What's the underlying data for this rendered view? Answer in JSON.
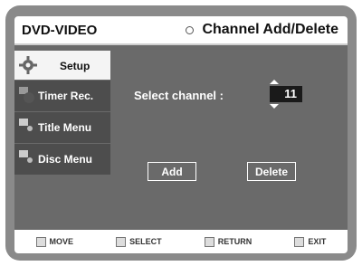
{
  "header": {
    "mode": "DVD-VIDEO",
    "title": "Channel Add/Delete"
  },
  "sidebar": {
    "items": [
      {
        "label": "Setup",
        "icon": "gear-icon",
        "active": true
      },
      {
        "label": "Timer Rec.",
        "icon": "timer-icon",
        "active": false
      },
      {
        "label": "Title Menu",
        "icon": "title-menu-icon",
        "active": false
      },
      {
        "label": "Disc Menu",
        "icon": "disc-menu-icon",
        "active": false
      }
    ]
  },
  "main": {
    "select_channel_label": "Select channel :",
    "channel_value": "11",
    "add_label": "Add",
    "delete_label": "Delete"
  },
  "footer": {
    "move": "MOVE",
    "select": "SELECT",
    "return": "RETURN",
    "exit": "EXIT"
  }
}
